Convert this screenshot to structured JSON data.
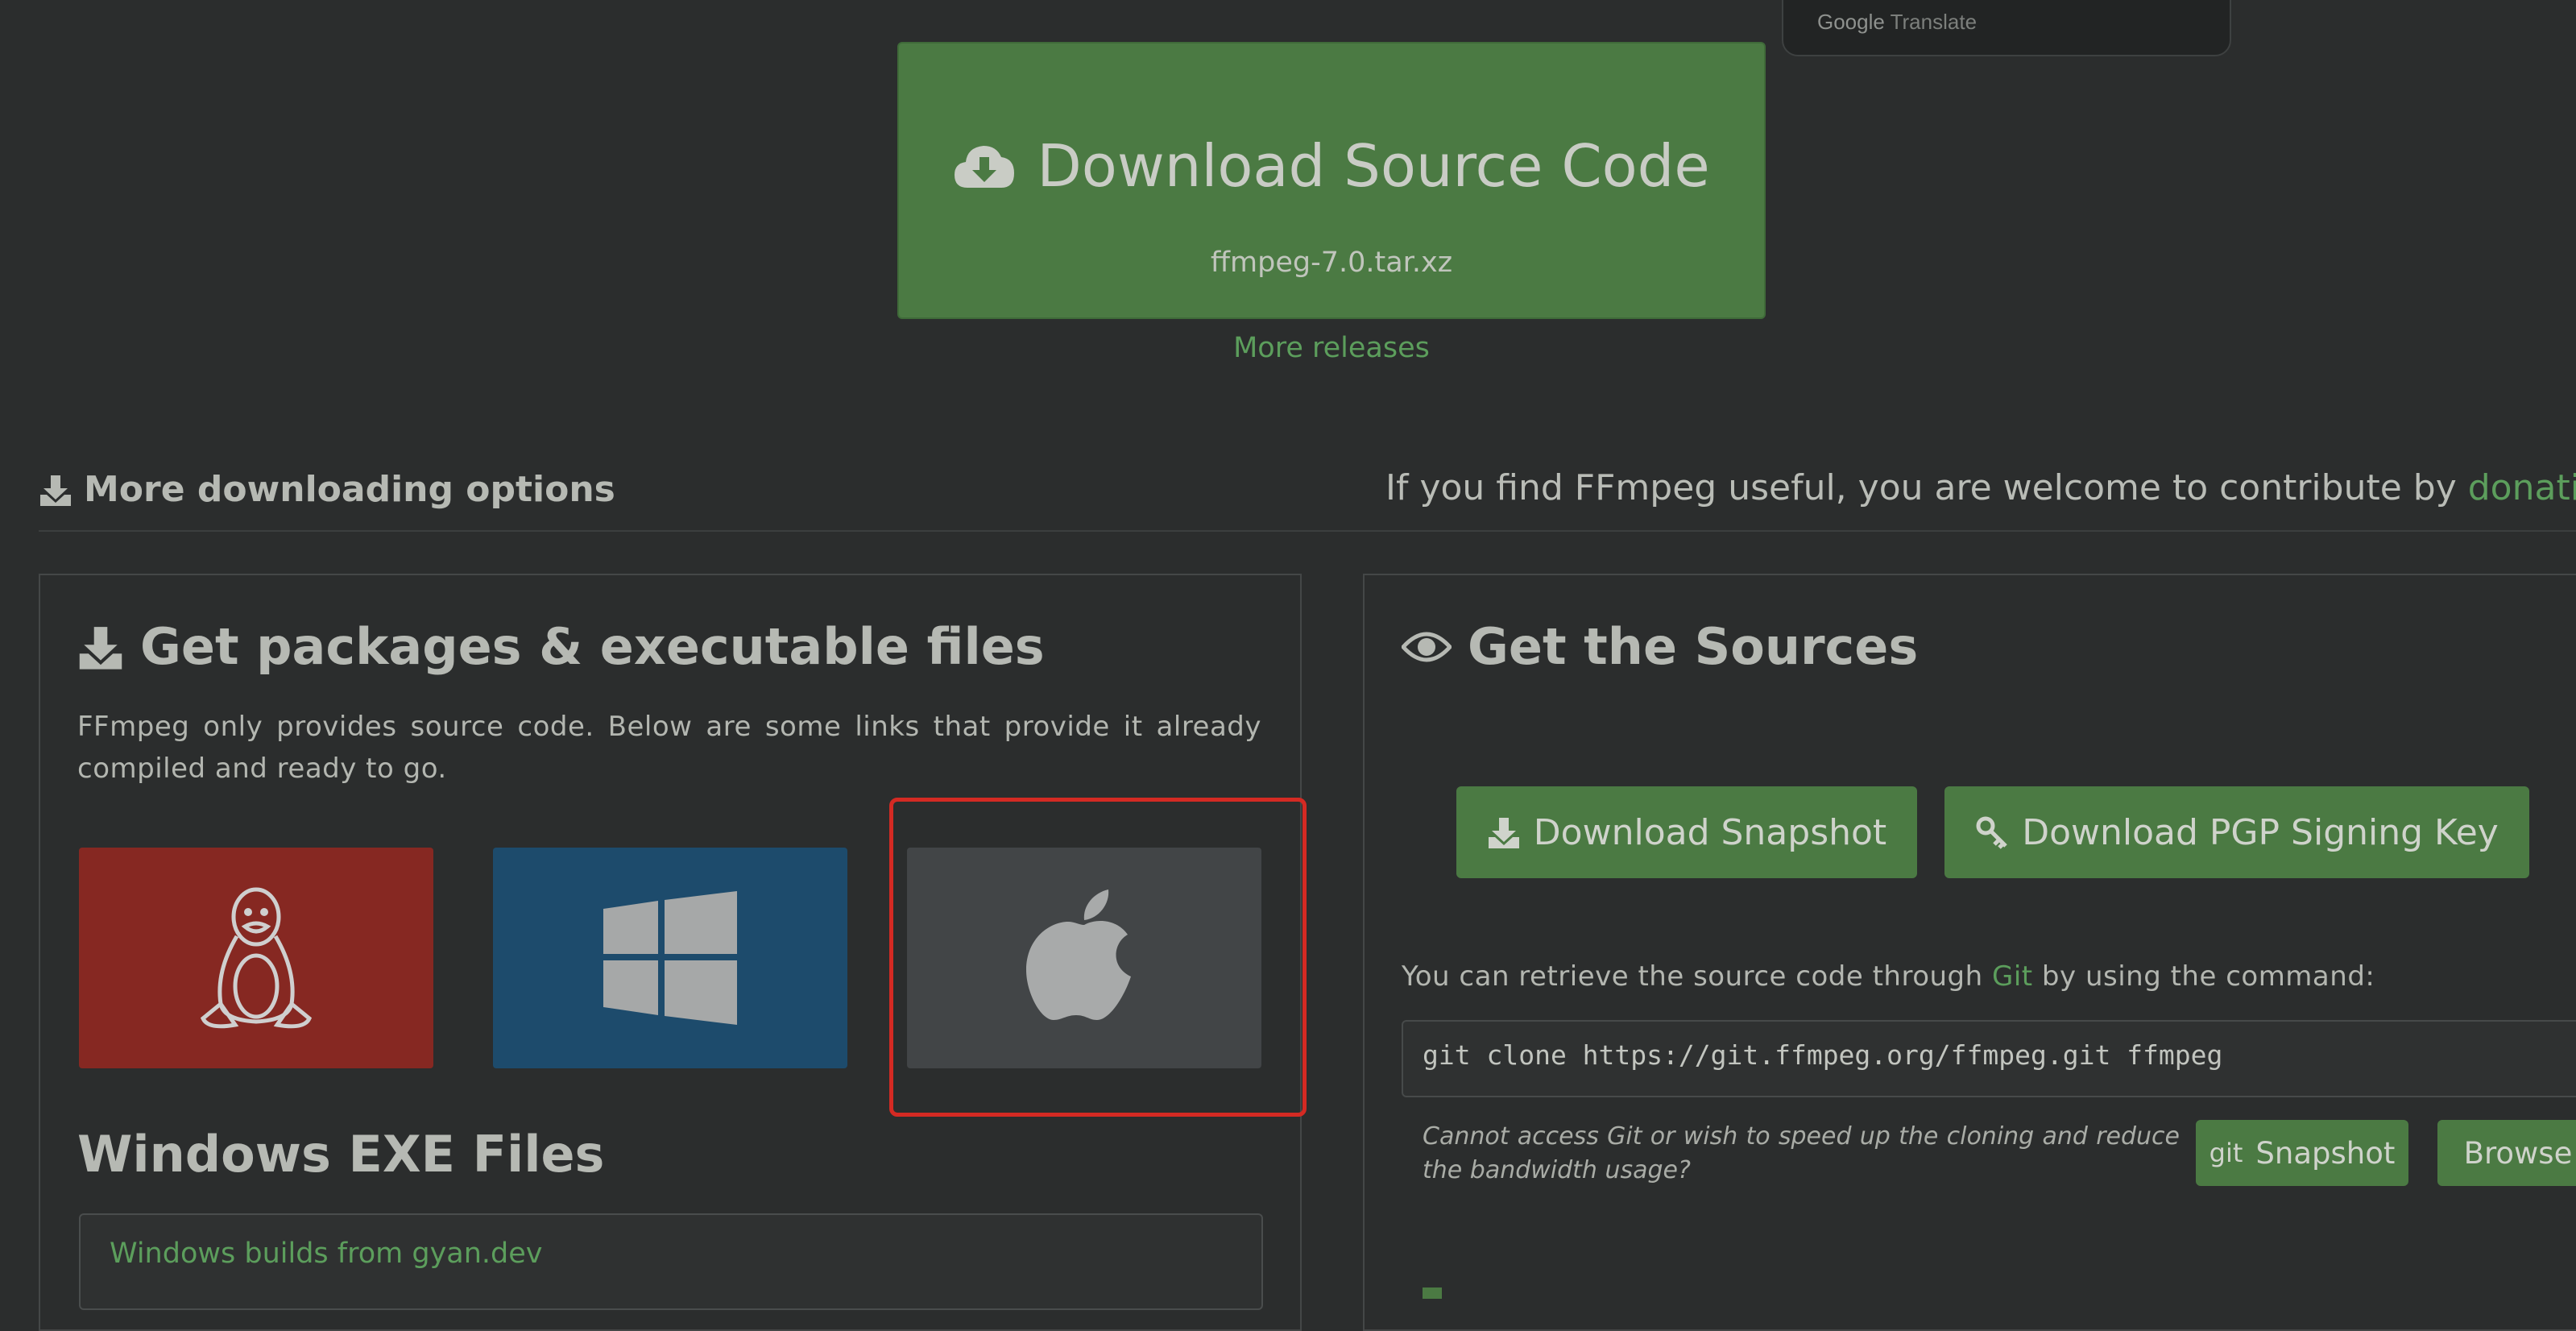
{
  "translate_popup": {
    "brand": "Google",
    "label": "Translate"
  },
  "download_source": {
    "title": "Download Source Code",
    "filename": "ffmpeg-7.0.tar.xz",
    "icon": "cloud-download-icon"
  },
  "more_releases": "More releases",
  "more_options": {
    "heading": "More downloading options",
    "icon": "download-tray-icon"
  },
  "contribute": {
    "text": "If you find FFmpeg useful, you are welcome to contribute by ",
    "link": "donatin"
  },
  "packages": {
    "title": "Get packages & executable files",
    "description": "FFmpeg only provides source code. Below are some links that provide it already compiled and ready to go.",
    "tiles": [
      {
        "name": "linux",
        "icon": "linux-tux-icon",
        "color": "#862822"
      },
      {
        "name": "windows",
        "icon": "windows-logo-icon",
        "color": "#1d4b6c"
      },
      {
        "name": "mac",
        "icon": "apple-logo-icon",
        "color": "#424547"
      }
    ],
    "windows_heading": "Windows EXE Files",
    "windows_links": [
      "Windows builds from gyan.dev"
    ]
  },
  "sources": {
    "title": "Get the Sources",
    "snapshot_button": "Download Snapshot",
    "pgp_button": "Download PGP Signing Key",
    "retrieve_pre": "You can retrieve the source code through ",
    "retrieve_link": "Git",
    "retrieve_post": " by using the command:",
    "command": "git clone https://git.ffmpeg.org/ffmpeg.git ffmpeg",
    "note": "Cannot access Git or wish to speed up the cloning and reduce the bandwidth usage?",
    "git_snapshot_prefix": "git",
    "git_snapshot_label": "Snapshot",
    "browse_button": "Browse"
  },
  "colors": {
    "accent_green": "#4b7a43",
    "link_green": "#5c9e5c",
    "highlight_red": "#d42a23",
    "background": "#2b2d2d"
  }
}
